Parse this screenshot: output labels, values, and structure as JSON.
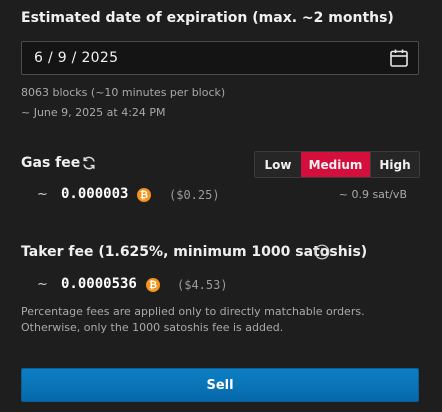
{
  "expiration": {
    "title": "Estimated date of expiration (max. ~2 months)",
    "date_value": "6 / 9 / 2025",
    "blocks_text": "8063 blocks (~10 minutes per block)",
    "approx_text": "~ June 9, 2025 at 4:24 PM"
  },
  "gas_fee": {
    "label": "Gas fee",
    "options": [
      "Low",
      "Medium",
      "High"
    ],
    "selected": "Medium",
    "tilde": "~",
    "amount": "0.000003",
    "usd": "($0.25)",
    "rate": "~ 0.9 sat/vB"
  },
  "taker_fee": {
    "label": "Taker fee (1.625%, minimum 1000 satoshis)",
    "tilde": "~",
    "amount": "0.0000536",
    "usd": "($4.53)",
    "note": "Percentage fees are applied only to directly matchable orders. Otherwise, only the 1000 satoshis fee is added."
  },
  "sell_label": "Sell",
  "icons": {
    "calendar": "calendar-icon",
    "refresh": "refresh-icon",
    "info": "info-icon",
    "bitcoin": "bitcoin-icon",
    "bitcoin_glyph": "₿"
  },
  "colors": {
    "accent_selected": "#d40f3e",
    "sell_button": "#0d7fc4",
    "bitcoin": "#f7931a"
  }
}
